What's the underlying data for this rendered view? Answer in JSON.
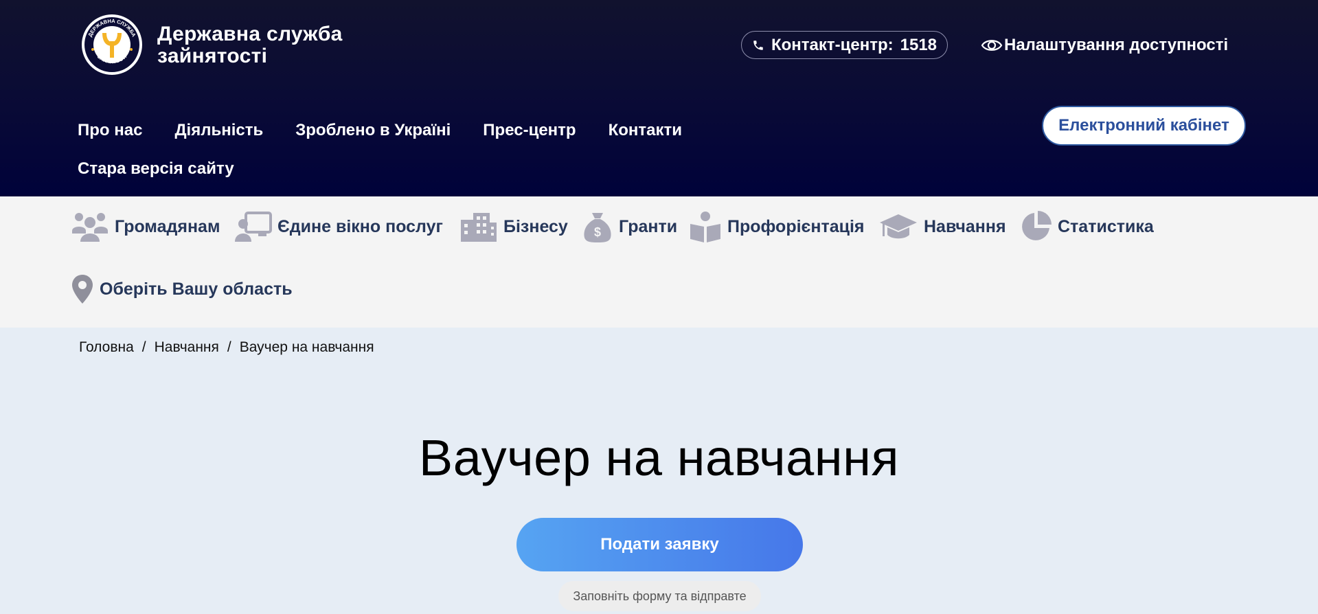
{
  "header": {
    "brand_line1": "Державна служба",
    "brand_line2": "зайнятості",
    "logo_text_top": "ДЕРЖАВНА СЛУЖБА",
    "logo_text_bottom": "ЗАЙНЯТОСТІ",
    "contact_label": "Контакт-центр:",
    "contact_number": "1518",
    "accessibility_label": "Налаштування доступності",
    "cabinet_label": "Електронний кабінет",
    "nav": [
      "Про нас",
      "Діяльність",
      "Зроблено в Україні",
      "Прес-центр",
      "Контакти"
    ],
    "old_site_label": "Стара версія сайту"
  },
  "categories": {
    "citizens": "Громадянам",
    "single_window": "Єдине вікно послуг",
    "business": "Бізнесу",
    "grants": "Гранти",
    "career": "Профорієнтація",
    "education": "Навчання",
    "statistics": "Статистика",
    "region": "Оберіть Вашу область"
  },
  "breadcrumb": {
    "home": "Головна",
    "education": "Навчання",
    "current": "Ваучер на навчання",
    "separator": "/"
  },
  "hero": {
    "title": "Ваучер на навчання",
    "apply_label": "Подати заявку",
    "apply_hint": "Заповніть форму та відправте"
  },
  "colors": {
    "header_bg": "#0a0b36",
    "icon_gray": "#a9a9b8",
    "category_text": "#26375a",
    "cabinet_border": "#2f5aa1",
    "button_gradient_start": "#56a4f2",
    "button_gradient_end": "#4677e9",
    "logo_accent": "#f4b326"
  }
}
